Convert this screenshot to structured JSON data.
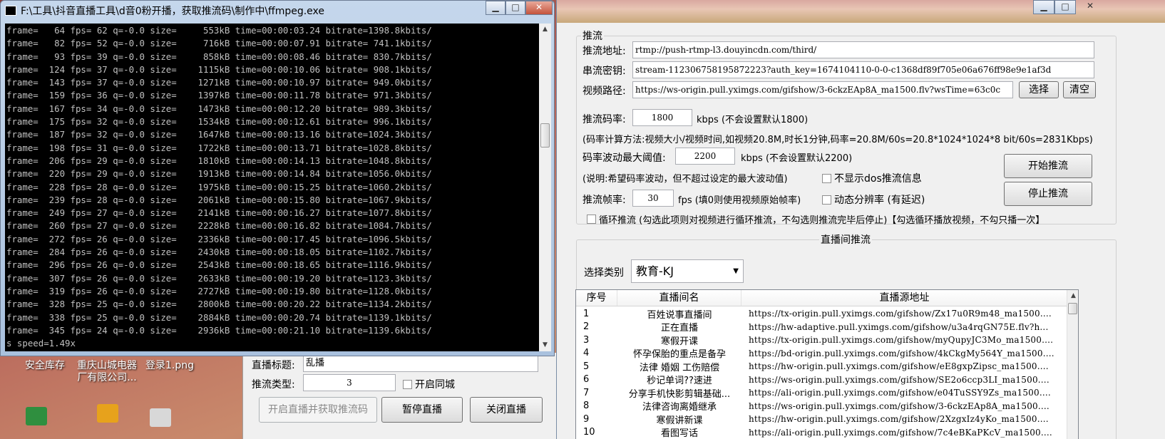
{
  "console": {
    "title": "F:\\工具\\抖音直播工具\\d音0粉开播，获取推流码\\制作中\\ffmpeg.exe",
    "buttons": [
      "▁",
      "□",
      "✕"
    ],
    "lines": [
      "frame=   64 fps= 62 q=-0.0 size=     553kB time=00:00:03.24 bitrate=1398.8kbits/",
      "frame=   82 fps= 52 q=-0.0 size=     716kB time=00:00:07.91 bitrate= 741.1kbits/",
      "frame=   93 fps= 39 q=-0.0 size=     858kB time=00:00:08.46 bitrate= 830.7kbits/",
      "frame=  124 fps= 37 q=-0.0 size=    1115kB time=00:00:10.06 bitrate= 908.1kbits/",
      "frame=  143 fps= 37 q=-0.0 size=    1271kB time=00:00:10.97 bitrate= 949.0kbits/",
      "frame=  159 fps= 36 q=-0.0 size=    1397kB time=00:00:11.78 bitrate= 971.3kbits/",
      "frame=  167 fps= 34 q=-0.0 size=    1473kB time=00:00:12.20 bitrate= 989.3kbits/",
      "frame=  175 fps= 32 q=-0.0 size=    1534kB time=00:00:12.61 bitrate= 996.1kbits/",
      "frame=  187 fps= 32 q=-0.0 size=    1647kB time=00:00:13.16 bitrate=1024.3kbits/",
      "frame=  198 fps= 31 q=-0.0 size=    1722kB time=00:00:13.71 bitrate=1028.8kbits/",
      "frame=  206 fps= 29 q=-0.0 size=    1810kB time=00:00:14.13 bitrate=1048.8kbits/",
      "frame=  220 fps= 29 q=-0.0 size=    1913kB time=00:00:14.84 bitrate=1056.0kbits/",
      "frame=  228 fps= 28 q=-0.0 size=    1975kB time=00:00:15.25 bitrate=1060.2kbits/",
      "frame=  239 fps= 28 q=-0.0 size=    2061kB time=00:00:15.80 bitrate=1067.9kbits/",
      "frame=  249 fps= 27 q=-0.0 size=    2141kB time=00:00:16.27 bitrate=1077.8kbits/",
      "frame=  260 fps= 27 q=-0.0 size=    2228kB time=00:00:16.82 bitrate=1084.7kbits/",
      "frame=  272 fps= 26 q=-0.0 size=    2336kB time=00:00:17.45 bitrate=1096.5kbits/",
      "frame=  284 fps= 26 q=-0.0 size=    2430kB time=00:00:18.05 bitrate=1102.7kbits/",
      "frame=  296 fps= 26 q=-0.0 size=    2543kB time=00:00:18.65 bitrate=1116.9kbits/",
      "frame=  307 fps= 26 q=-0.0 size=    2633kB time=00:00:19.20 bitrate=1123.3kbits/",
      "frame=  319 fps= 26 q=-0.0 size=    2727kB time=00:00:19.80 bitrate=1128.0kbits/",
      "frame=  328 fps= 25 q=-0.0 size=    2800kB time=00:00:20.22 bitrate=1134.2kbits/",
      "frame=  338 fps= 25 q=-0.0 size=    2884kB time=00:00:20.74 bitrate=1139.1kbits/",
      "frame=  345 fps= 24 q=-0.0 size=    2936kB time=00:00:21.10 bitrate=1139.6kbits/",
      "s speed=1.49x"
    ]
  },
  "desktop": {
    "icons": [
      "安全库存",
      "重庆山城电器\n厂有限公司...",
      "登录1.png"
    ]
  },
  "leftapp": {
    "title_label": "直播标题:",
    "title_value": "乱播",
    "type_label": "推流类型:",
    "type_value": "3",
    "sync_label": "开启同城",
    "start_button": "开启直播并获取推流码",
    "pause_button": "暂停直播",
    "close_button": "关闭直播"
  },
  "appwin": {
    "buttons": [
      "▁",
      "□",
      "✕"
    ],
    "push": {
      "group_label": "推流",
      "url_label": "推流地址:",
      "url_value": "rtmp://push-rtmp-l3.douyincdn.com/third/",
      "key_label": "串流密钥:",
      "key_value": "stream-112306758195872223?auth_key=1674104110-0-0-c1368df89f705e06a676ff98e9e1af3d",
      "video_label": "视频路径:",
      "video_value": "https://ws-origin.pull.yximgs.com/gifshow/3-6ckzEAp8A_ma1500.flv?wsTime=63c0c",
      "select_button": "选择",
      "clear_button": "清空",
      "bitrate_label": "推流码率:",
      "bitrate_value": "1800",
      "bitrate_unit": "kbps (不会设置默认1800)",
      "bitrate_note": "(码率计算方法:视频大小/视频时间,如视频20.8M,时长1分钟,码率=20.8M/60s=20.8*1024*1024*8 bit/60s=2831Kbps)",
      "maxrate_label": "码率波动最大阈值:",
      "maxrate_value": "2200",
      "maxrate_unit": "kbps (不会设置默认2200)",
      "maxrate_note": "(说明:希望码率波动，但不超过设定的最大波动值)",
      "hide_dos_label": "不显示dos推流信息",
      "fps_label": "推流帧率:",
      "fps_value": "30",
      "fps_unit": "fps (填0则使用视频原始帧率)",
      "dynamic_res_label": "动态分辨率 (有延迟)",
      "loop_label": "循环推流 (勾选此项则对视频进行循环推流，不勾选则推流完毕后停止)【勾选循环播放视频，不勾只播一次】",
      "start_button": "开始推流",
      "stop_button": "停止推流"
    },
    "room": {
      "group_label": "直播间推流",
      "category_label": "选择类别",
      "category_value": "教育-KJ",
      "columns": [
        "序号",
        "直播间名",
        "直播源地址"
      ],
      "rows": [
        [
          "1",
          "百姓说事直播间",
          "https://tx-origin.pull.yximgs.com/gifshow/Zx17u0R9m48_ma1500...."
        ],
        [
          "2",
          "正在直播",
          "https://hw-adaptive.pull.yximgs.com/gifshow/u3a4rqGN75E.flv?h..."
        ],
        [
          "3",
          "寒假开课",
          "https://tx-origin.pull.yximgs.com/gifshow/myQupyJC3Mo_ma1500...."
        ],
        [
          "4",
          "怀孕保胎的重点是备孕",
          "https://bd-origin.pull.yximgs.com/gifshow/4kCkgMy564Y_ma1500...."
        ],
        [
          "5",
          "法律 婚姻 工伤赔偿",
          "https://hw-origin.pull.yximgs.com/gifshow/eE8gxpZipsc_ma1500...."
        ],
        [
          "6",
          "秒记单词??速进",
          "https://ws-origin.pull.yximgs.com/gifshow/SE2o6ccp3LI_ma1500...."
        ],
        [
          "7",
          "分享手机快影剪辑基础...",
          "https://ali-origin.pull.yximgs.com/gifshow/e04TuSSY9Zs_ma1500...."
        ],
        [
          "8",
          "法律咨询离婚继承",
          "https://ws-origin.pull.yximgs.com/gifshow/3-6ckzEAp8A_ma1500...."
        ],
        [
          "9",
          "寒假讲新课",
          "https://hw-origin.pull.yximgs.com/gifshow/2XzgxIz4yKo_ma1500...."
        ],
        [
          "10",
          "看图写话",
          "https://ali-origin.pull.yximgs.com/gifshow/7c4eBKaPKcV_ma1500...."
        ]
      ]
    }
  }
}
